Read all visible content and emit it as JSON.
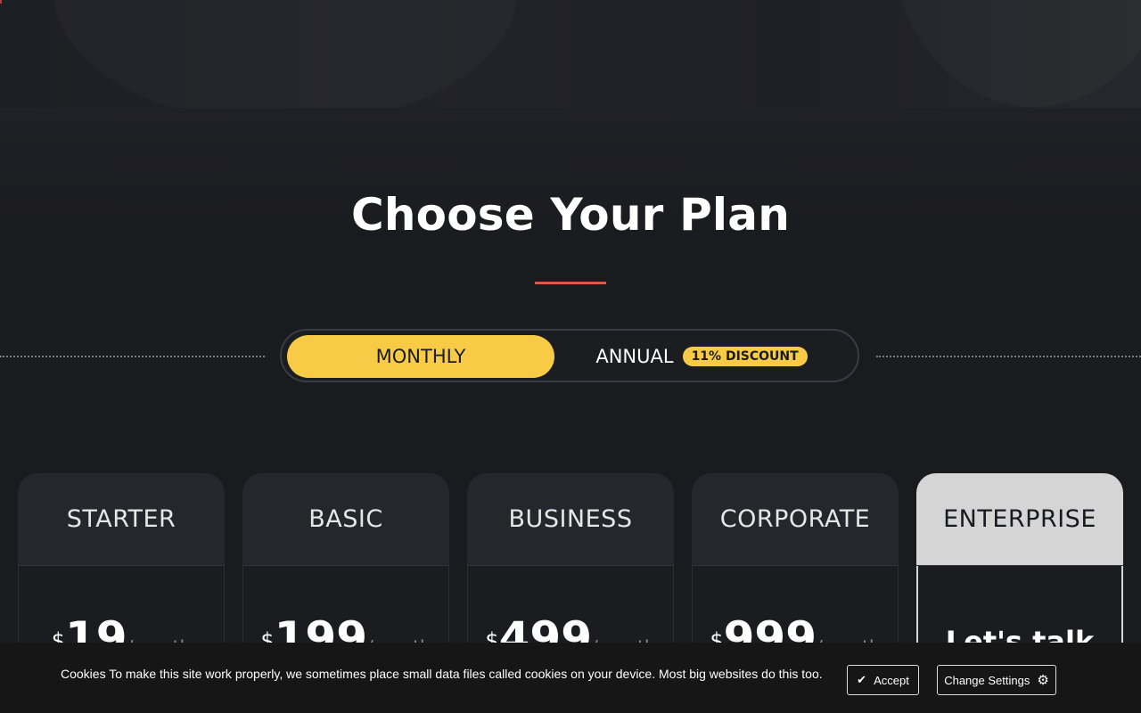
{
  "page": {
    "title": "Choose Your Plan"
  },
  "billing_toggle": {
    "monthly_label": "MONTHLY",
    "annual_label": "ANNUAL",
    "discount_badge": "11% DISCOUNT",
    "selected": "MONTHLY"
  },
  "plans": [
    {
      "name": "STARTER",
      "currency": "$",
      "price": "19",
      "period": "/month"
    },
    {
      "name": "BASIC",
      "currency": "$",
      "price": "199",
      "period": "/month"
    },
    {
      "name": "BUSINESS",
      "currency": "$",
      "price": "499",
      "period": "/month"
    },
    {
      "name": "CORPORATE",
      "currency": "$",
      "price": "999",
      "period": "/month"
    },
    {
      "name": "ENTERPRISE",
      "cta": "Let's talk"
    }
  ],
  "cookie_banner": {
    "text": "Cookies To make this site work properly, we sometimes place small data files called cookies on your device. Most big websites do this too.",
    "accept_label": "Accept",
    "settings_label": "Change Settings",
    "accept_icon": "check-icon",
    "settings_icon": "gear-icon"
  },
  "colors": {
    "accent_yellow": "#f7cb46",
    "accent_red": "#e25641",
    "background": "#1a1b1f",
    "enterprise_header": "#d5d5d5"
  }
}
